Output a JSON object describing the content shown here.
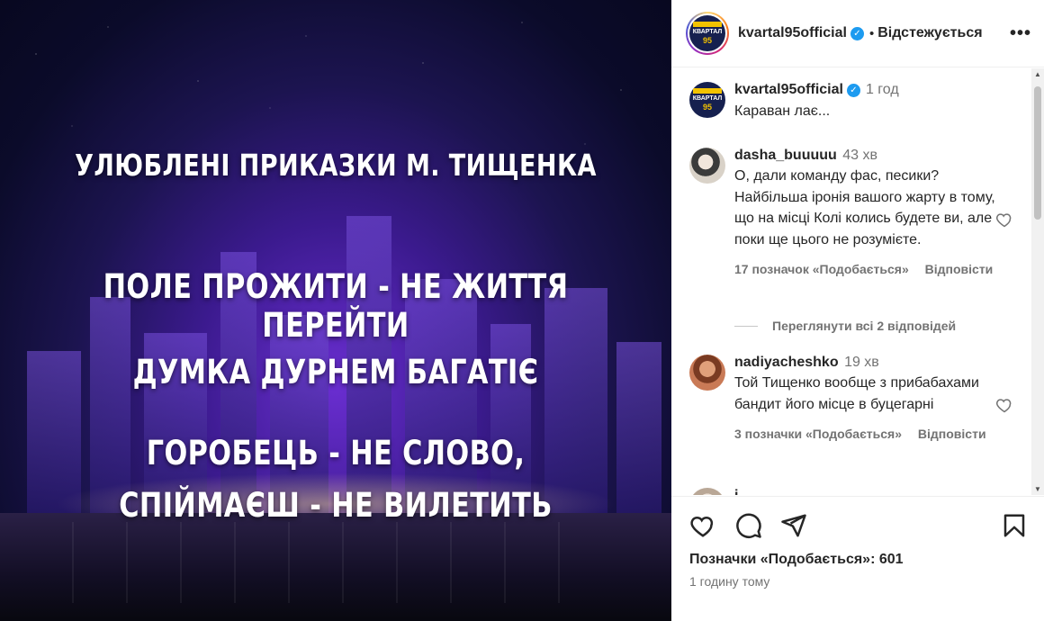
{
  "media": {
    "title": "УЛЮБЛЕНІ ПРИКАЗКИ М. ТИЩЕНКА",
    "lines": [
      "ПОЛЕ ПРОЖИТИ - НЕ ЖИТТЯ ПЕРЕЙТИ",
      "ДУМКА ДУРНЕМ БАГАТІЄ",
      "ГОРОБЕЦЬ -  НЕ СЛОВО,",
      "СПІЙМАЄШ - НЕ ВИЛЕТИТЬ"
    ]
  },
  "header": {
    "username": "kvartal95official",
    "logo_text": "КВАРТАЛ",
    "logo_number": "95",
    "separator": "•",
    "follow_label": "Відстежується",
    "more_icon": "more-horizontal-icon"
  },
  "caption": {
    "username": "kvartal95official",
    "time": "1 год",
    "text": "Караван лає..."
  },
  "comments": [
    {
      "username": "dasha_buuuuu",
      "time": "43 хв",
      "text": "О, дали команду фас, песики? Найбільша іронія вашого жарту в тому, що на місці Колі колись будете ви, але поки ще цього не розумієте.",
      "likes": "17 позначок «Подобається»",
      "reply": "Відповісти"
    },
    {
      "username": "nadiyacheshko",
      "time": "19 хв",
      "text": "Той Тищенко вообще з прибабахами бандит його місце в буцегарні",
      "likes": "3 позначки «Подобається»",
      "reply": "Відповісти"
    }
  ],
  "view_replies": "Переглянути всі 2 відповідей",
  "partial_comment_username": "i...",
  "actions": {
    "like_icon": "heart-icon",
    "comment_icon": "comment-icon",
    "share_icon": "send-icon",
    "save_icon": "bookmark-icon",
    "likes_text": "Позначки «Подобається»: 601",
    "posted_time": "1 годину тому"
  },
  "colors": {
    "verified": "#1d9bf0",
    "muted": "#737373",
    "text": "#262626"
  }
}
